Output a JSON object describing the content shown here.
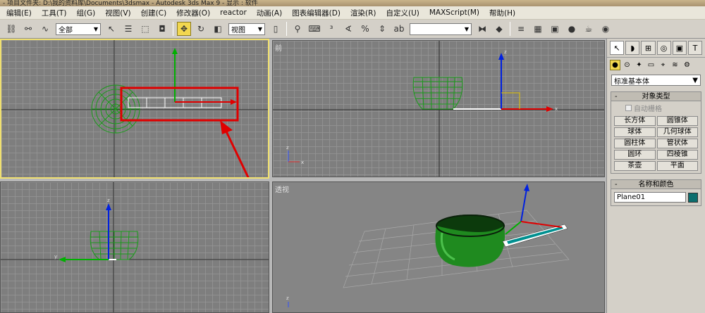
{
  "window": {
    "title": "- 项目文件夹: D:\\我的资料库\\Documents\\3dsmax    - Autodesk 3ds Max 9    - 显示 : 软件"
  },
  "menubar": {
    "items": [
      "编辑(E)",
      "工具(T)",
      "组(G)",
      "视图(V)",
      "创建(C)",
      "修改器(O)",
      "reactor",
      "动画(A)",
      "图表编辑器(D)",
      "渲染(R)",
      "自定义(U)",
      "MAXScript(M)",
      "帮助(H)"
    ]
  },
  "toolbar": {
    "selection_filter": "全部",
    "ref_coord": "视图",
    "named_selection": ""
  },
  "viewports": {
    "top_label": "",
    "front_label": "前",
    "left_label": "",
    "persp_label": "透视"
  },
  "axis_labels": {
    "x": "x",
    "y": "y",
    "z": "z"
  },
  "command_panel": {
    "category_dropdown": "标准基本体",
    "object_type": {
      "title": "对象类型",
      "autogrid": "自动栅格",
      "buttons": [
        "长方体",
        "圆锥体",
        "球体",
        "几何球体",
        "圆柱体",
        "管状体",
        "圆环",
        "四棱锥",
        "茶壶",
        "平面"
      ]
    },
    "name_color": {
      "title": "名称和颜色",
      "name_value": "Plane01",
      "color": "#0c6e6e"
    }
  },
  "colors": {
    "selection_highlight": "#e00000",
    "wireframe": "#1a9a1a",
    "active_viewport_border": "#f0e070",
    "gizmo_x": "#e00000",
    "gizmo_y": "#00b000",
    "gizmo_z": "#0020e0"
  }
}
